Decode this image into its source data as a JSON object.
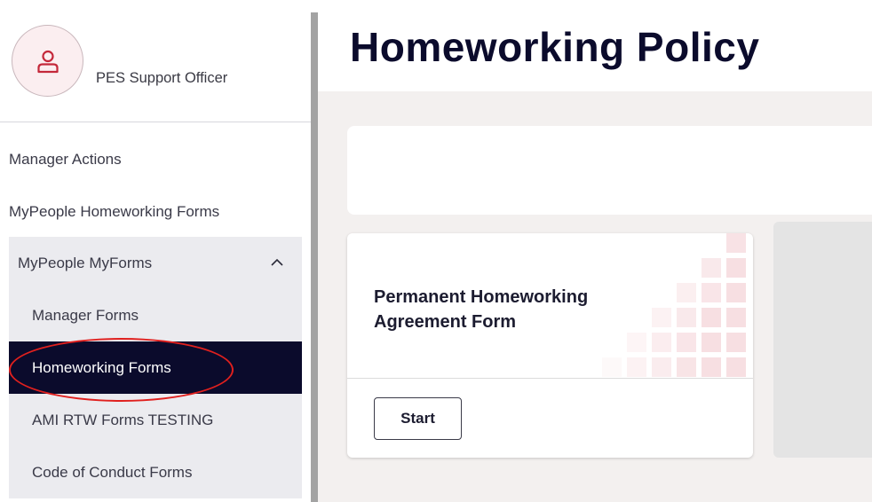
{
  "profile": {
    "name": "PES Support Officer",
    "avatar_icon": "user-icon"
  },
  "sidebar": {
    "items": [
      {
        "label": "Manager Actions"
      },
      {
        "label": "MyPeople Homeworking Forms"
      }
    ],
    "group": {
      "label": "MyPeople MyForms",
      "expanded": true,
      "chevron_icon": "chevron-up-icon",
      "children": [
        {
          "label": "Manager Forms",
          "active": false
        },
        {
          "label": "Homeworking Forms",
          "active": true
        },
        {
          "label": "AMI RTW Forms TESTING",
          "active": false
        },
        {
          "label": "Code of Conduct Forms",
          "active": false
        }
      ]
    }
  },
  "main": {
    "title": "Homeworking Policy",
    "cards": [
      {
        "title": "Permanent Homeworking Agreement Form",
        "button_label": "Start"
      }
    ]
  },
  "colors": {
    "nav_active_bg": "#0b0b2c",
    "nav_group_bg": "#ebebef",
    "avatar_bg": "#fbeef0",
    "avatar_icon": "#c4283a",
    "highlight_ring": "#e0201e",
    "page_bg": "#f3f0ef"
  }
}
